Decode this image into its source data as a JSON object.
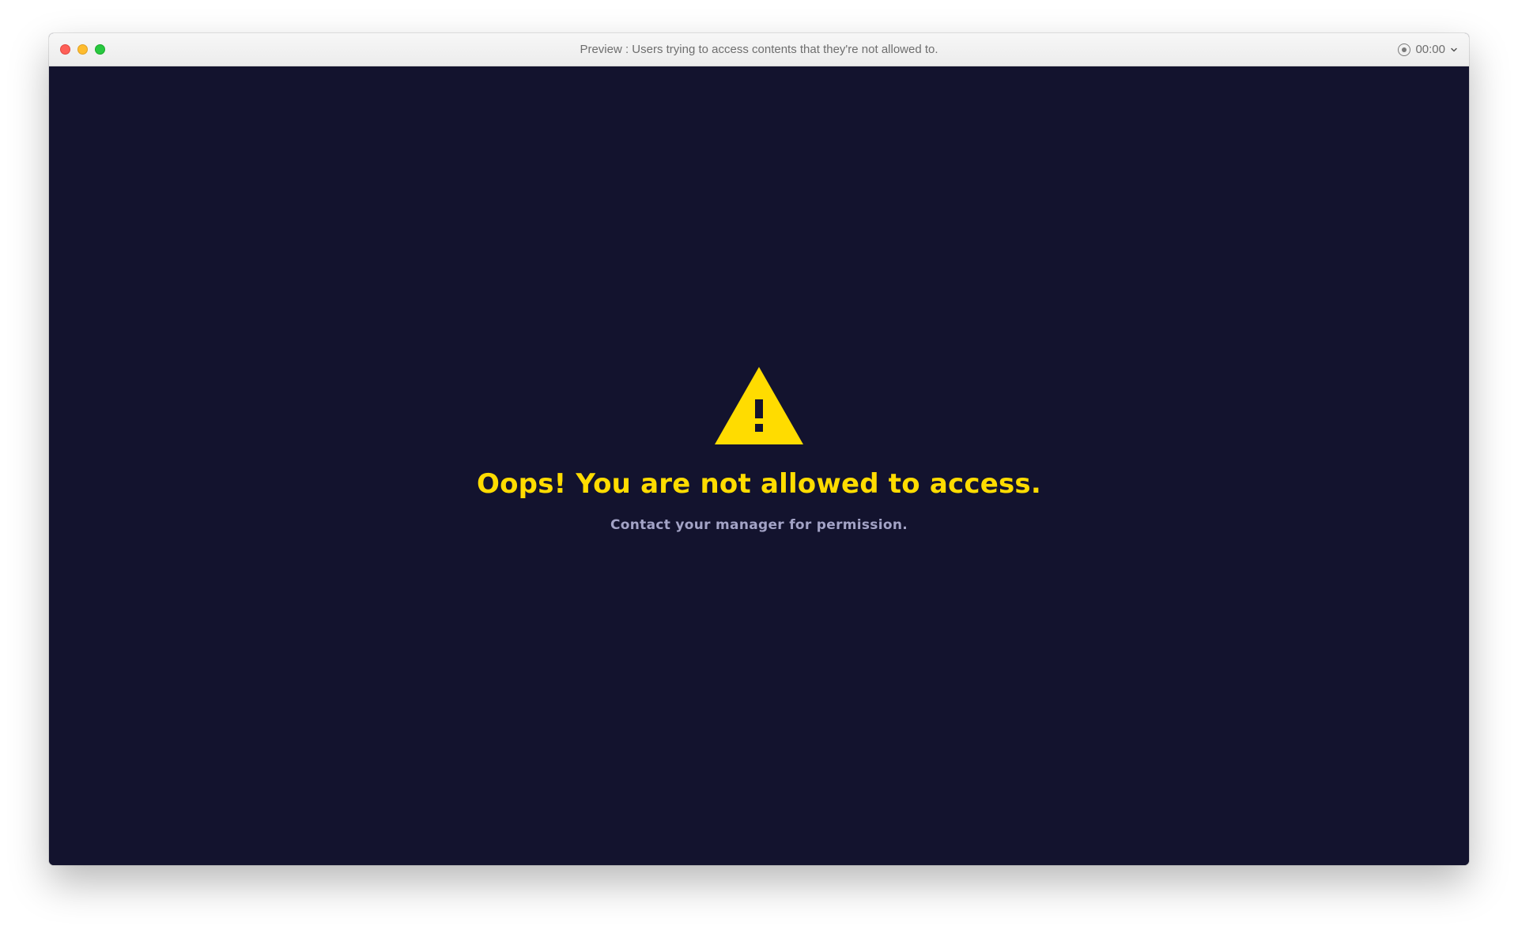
{
  "window": {
    "title": "Preview : Users trying to access contents that they're not allowed to.",
    "timer": "00:00"
  },
  "icons": {
    "close": "close-dot",
    "minimize": "minimize-dot",
    "maximize": "maximize-dot",
    "record": "record-icon",
    "chevron": "chevron-down-icon",
    "warning": "warning-triangle-icon"
  },
  "error": {
    "heading": "Oops! You are not allowed to access.",
    "subtext": "Contact your manager for permission."
  },
  "colors": {
    "background": "#13132e",
    "accent": "#ffdc00",
    "subtext": "#a3a3c6"
  }
}
